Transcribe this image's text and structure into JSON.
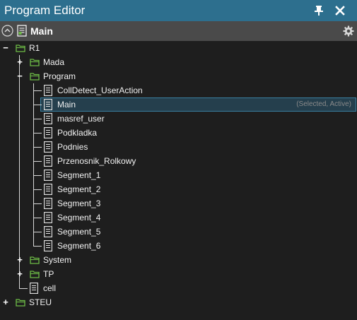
{
  "window": {
    "title": "Program Editor"
  },
  "header": {
    "title": "Main"
  },
  "tree": {
    "root": "R1",
    "groups": [
      "Mada",
      "Program",
      "System",
      "TP"
    ],
    "program_items": [
      "CollDetect_UserAction",
      "Main",
      "masref_user",
      "Podkladka",
      "Podnies",
      "Przenosnik_Rolkowy",
      "Segment_1",
      "Segment_2",
      "Segment_3",
      "Segment_4",
      "Segment_5",
      "Segment_6"
    ],
    "selected_status": "(Selected, Active)",
    "r1_file": "cell",
    "other_root": "STEU"
  },
  "icons": {
    "pin": "pin-icon",
    "close": "close-icon",
    "collapse": "collapse-circle-icon",
    "settings": "gear-icon",
    "folder": "folder-icon",
    "document": "document-icon"
  },
  "colors": {
    "title_bar": "#2d6f8e",
    "header_bar": "#4a4a4a",
    "background": "#1e1e1e",
    "folder": "#6dbb46",
    "selection": "#253f4d",
    "selection_border": "#3a7fa0"
  }
}
